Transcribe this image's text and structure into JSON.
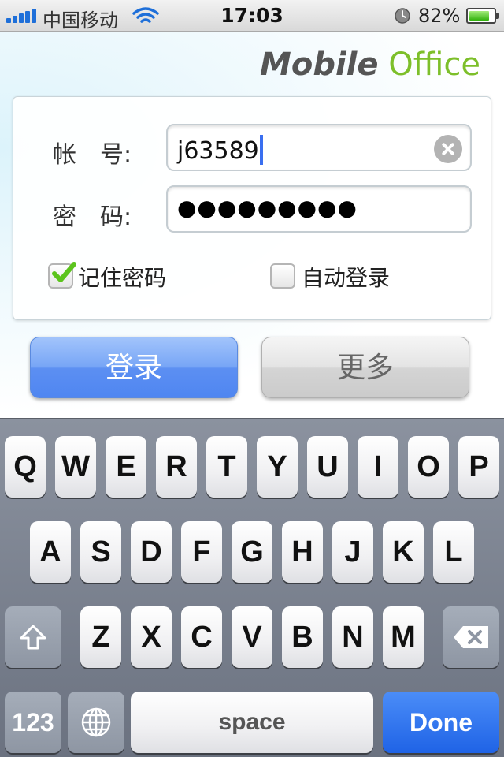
{
  "status_bar": {
    "carrier": "中国移动",
    "time": "17:03",
    "battery_percent": "82%",
    "battery_level": 0.82
  },
  "brand": {
    "part1": "Mobile",
    "part2": "Office",
    "accent_color": "#7dbf2a"
  },
  "login_form": {
    "account_label": "帐　号:",
    "account_value": "j63589",
    "password_label": "密　码:",
    "password_mask": "●●●●●●●●●",
    "remember_password": {
      "label": "记住密码",
      "checked": true
    },
    "auto_login": {
      "label": "自动登录",
      "checked": false
    }
  },
  "buttons": {
    "login": "登录",
    "more": "更多"
  },
  "keyboard": {
    "row1": [
      "Q",
      "W",
      "E",
      "R",
      "T",
      "Y",
      "U",
      "I",
      "O",
      "P"
    ],
    "row2": [
      "A",
      "S",
      "D",
      "F",
      "G",
      "H",
      "J",
      "K",
      "L"
    ],
    "row3": [
      "Z",
      "X",
      "C",
      "V",
      "B",
      "N",
      "M"
    ],
    "numbers_key": "123",
    "space_key": "space",
    "done_key": "Done"
  }
}
